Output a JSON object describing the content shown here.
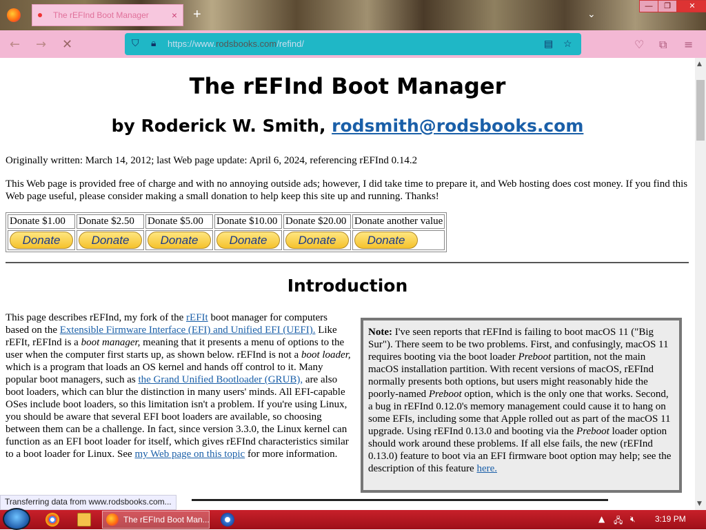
{
  "browser": {
    "tab_title": "The rEFInd Boot Manager",
    "tab_close": "×",
    "new_tab": "+",
    "url_prefix": "https://www.",
    "url_domain": "rodsbooks.com",
    "url_path": "/refind/",
    "status_text": "Transferring data from www.rodsbooks.com...",
    "window_min": "—",
    "window_max": "❐",
    "window_close": "✕"
  },
  "page": {
    "title": "The rEFInd Boot Manager",
    "by_prefix": "by Roderick W. Smith, ",
    "email": "rodsmith@rodsbooks.com",
    "dates": "Originally written: March 14, 2012; last Web page update: April 6, 2024, referencing rEFInd 0.14.2",
    "donation_note": "This Web page is provided free of charge and with no annoying outside ads; however, I did take time to prepare it, and Web hosting does cost money. If you find this Web page useful, please consider making a small donation to help keep this site up and running. Thanks!",
    "donations": [
      {
        "label": "Donate $1.00",
        "button": "Donate"
      },
      {
        "label": "Donate $2.50",
        "button": "Donate"
      },
      {
        "label": "Donate $5.00",
        "button": "Donate"
      },
      {
        "label": "Donate $10.00",
        "button": "Donate"
      },
      {
        "label": "Donate $20.00",
        "button": "Donate"
      },
      {
        "label": "Donate another value",
        "button": "Donate"
      }
    ],
    "intro_heading": "Introduction",
    "intro": {
      "t1": "This page describes rEFInd, my fork of the ",
      "l1": "rEFIt",
      "t2": " boot manager for computers based on the ",
      "l2": "Extensible Firmware Interface (EFI) and Unified EFI (UEFI).",
      "t3": " Like rEFIt, rEFInd is a ",
      "e1": "boot manager,",
      "t4": " meaning that it presents a menu of options to the user when the computer first starts up, as shown below. rEFInd is not a ",
      "e2": "boot loader,",
      "t5": " which is a program that loads an OS kernel and hands off control to it. Many popular boot managers, such as ",
      "l3": "the Grand Unified Bootloader (GRUB),",
      "t6": " are also boot loaders, which can blur the distinction in many users' minds. All EFI-capable OSes include boot loaders, so this limitation isn't a problem. If you're using Linux, you should be aware that several EFI boot loaders are available, so choosing between them can be a challenge. In fact, since version 3.3.0, the Linux kernel can function as an EFI boot loader for itself, which gives rEFInd characteristics similar to a boot loader for Linux. See ",
      "l4": "my Web page on this topic",
      "t7": " for more information."
    },
    "note": {
      "label": "Note:",
      "t1": " I've seen reports that rEFInd is failing to boot macOS 11 (\"Big Sur\"). There seem to be two problems. First, and confusingly, macOS 11 requires booting via the boot loader ",
      "e1": "Preboot",
      "t2": " partition, not the main macOS installation partition. With recent versions of macOS, rEFInd normally presents both options, but users might reasonably hide the poorly-named ",
      "e2": "Preboot",
      "t3": " option, which is the only one that works. Second, a bug in rEFInd 0.12.0's memory management could cause it to hang on some EFIs, including some that Apple rolled out as part of the macOS 11 upgrade. Using rEFInd 0.13.0 and booting via the ",
      "e3": "Preboot",
      "t4": " loader option should work around these problems. If all else fails, the new (rEFInd 0.13.0) feature to boot via an EFI firmware boot option may help; see the description of this feature ",
      "link": "here."
    }
  },
  "taskbar": {
    "task_label": "The rEFInd Boot Man...",
    "clock": "3:19 PM"
  }
}
